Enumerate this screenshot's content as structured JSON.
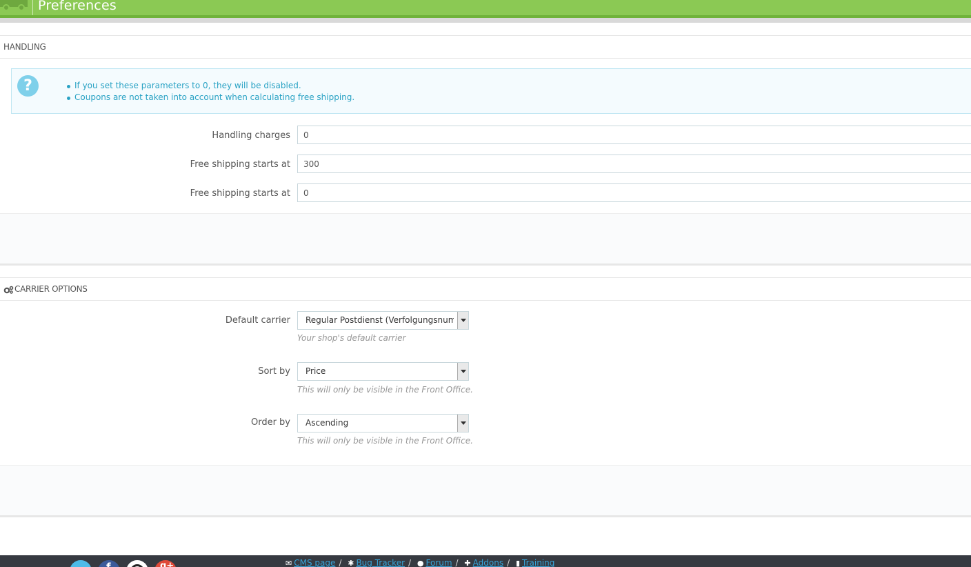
{
  "header": {
    "title": "Preferences",
    "bg_color": "#8bc954",
    "icon": "truck-icon"
  },
  "handling": {
    "heading": "HANDLING",
    "info_items": [
      "If you set these parameters to 0, they will be disabled.",
      "Coupons are not taken into account when calculating free shipping."
    ],
    "info_icon": "question-icon",
    "fields": [
      {
        "label": "Handling charges",
        "value": "0"
      },
      {
        "label": "Free shipping starts at",
        "value": "300"
      },
      {
        "label": "Free shipping starts at",
        "value": "0"
      }
    ]
  },
  "carrier_options": {
    "heading": "CARRIER OPTIONS",
    "heading_icon": "cogs-icon",
    "default_carrier": {
      "label": "Default carrier",
      "value": "Regular Postdienst (Verfolgungsnummer)",
      "help": "Your shop's default carrier"
    },
    "sort_by": {
      "label": "Sort by",
      "value": "Price",
      "help": "This will only be visible in the Front Office."
    },
    "order_by": {
      "label": "Order by",
      "value": "Ascending",
      "help": "This will only be visible in the Front Office."
    }
  },
  "footer": {
    "social": [
      "twitter-icon",
      "facebook-icon",
      "github-icon",
      "google-plus-icon"
    ],
    "links": [
      {
        "label": "CMS page",
        "icon": "envelope-icon"
      },
      {
        "label": "Bug Tracker",
        "icon": "bug-icon"
      },
      {
        "label": "Forum",
        "icon": "comments-icon"
      },
      {
        "label": "Addons",
        "icon": "puzzle-icon"
      },
      {
        "label": "Training",
        "icon": "book-icon"
      }
    ],
    "bg_color": "#363a41",
    "link_color": "#37a3d8"
  }
}
